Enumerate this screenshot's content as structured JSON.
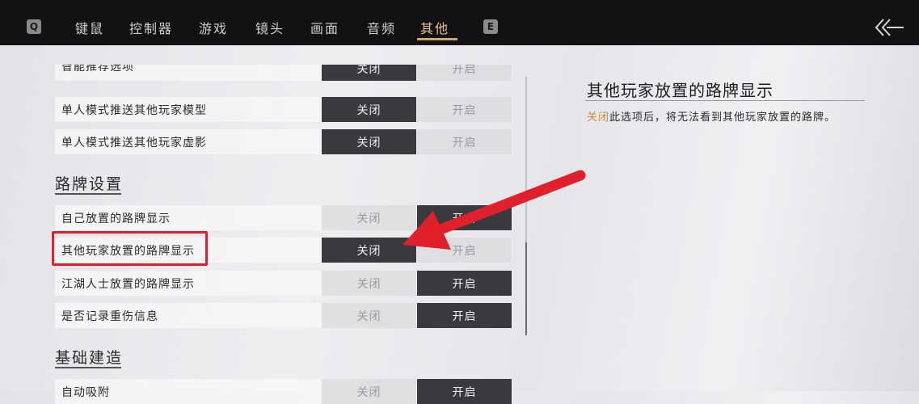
{
  "topbar": {
    "left_key": "Q",
    "right_key": "E",
    "tabs": [
      {
        "label": "键鼠"
      },
      {
        "label": "控制器"
      },
      {
        "label": "游戏"
      },
      {
        "label": "镜头"
      },
      {
        "label": "画面"
      },
      {
        "label": "音频"
      },
      {
        "label": "其他",
        "active": true
      }
    ],
    "back_icon": "double-chevron-left-icon"
  },
  "settings": {
    "rows_top": [
      {
        "label": "智能推荐选项",
        "off": "关闭",
        "on": "开启",
        "selected": "off"
      },
      {
        "label": "单人模式推送其他玩家模型",
        "off": "关闭",
        "on": "开启",
        "selected": "off"
      },
      {
        "label": "单人模式推送其他玩家虚影",
        "off": "关闭",
        "on": "开启",
        "selected": "off"
      }
    ],
    "section_signpost": "路牌设置",
    "rows_signpost": [
      {
        "label": "自己放置的路牌显示",
        "off": "关闭",
        "on": "开启",
        "selected": "on"
      },
      {
        "label": "其他玩家放置的路牌显示",
        "off": "关闭",
        "on": "开启",
        "selected": "off"
      },
      {
        "label": "江湖人士放置的路牌显示",
        "off": "关闭",
        "on": "开启",
        "selected": "on"
      },
      {
        "label": "是否记录重伤信息",
        "off": "关闭",
        "on": "开启",
        "selected": "on"
      }
    ],
    "section_build": "基础建造",
    "rows_build": [
      {
        "label": "自动吸附",
        "off": "关闭",
        "on": "开启",
        "selected": "on"
      }
    ]
  },
  "description": {
    "title": "其他玩家放置的路牌显示",
    "highlight": "关闭",
    "text": "此选项后，将无法看到其他玩家放置的路牌。"
  },
  "colors": {
    "accent_tab": "#e2c48a",
    "annotation_red": "#e0202a",
    "selected_option": "#3a3a3e",
    "highlight_text": "#c9883a"
  }
}
